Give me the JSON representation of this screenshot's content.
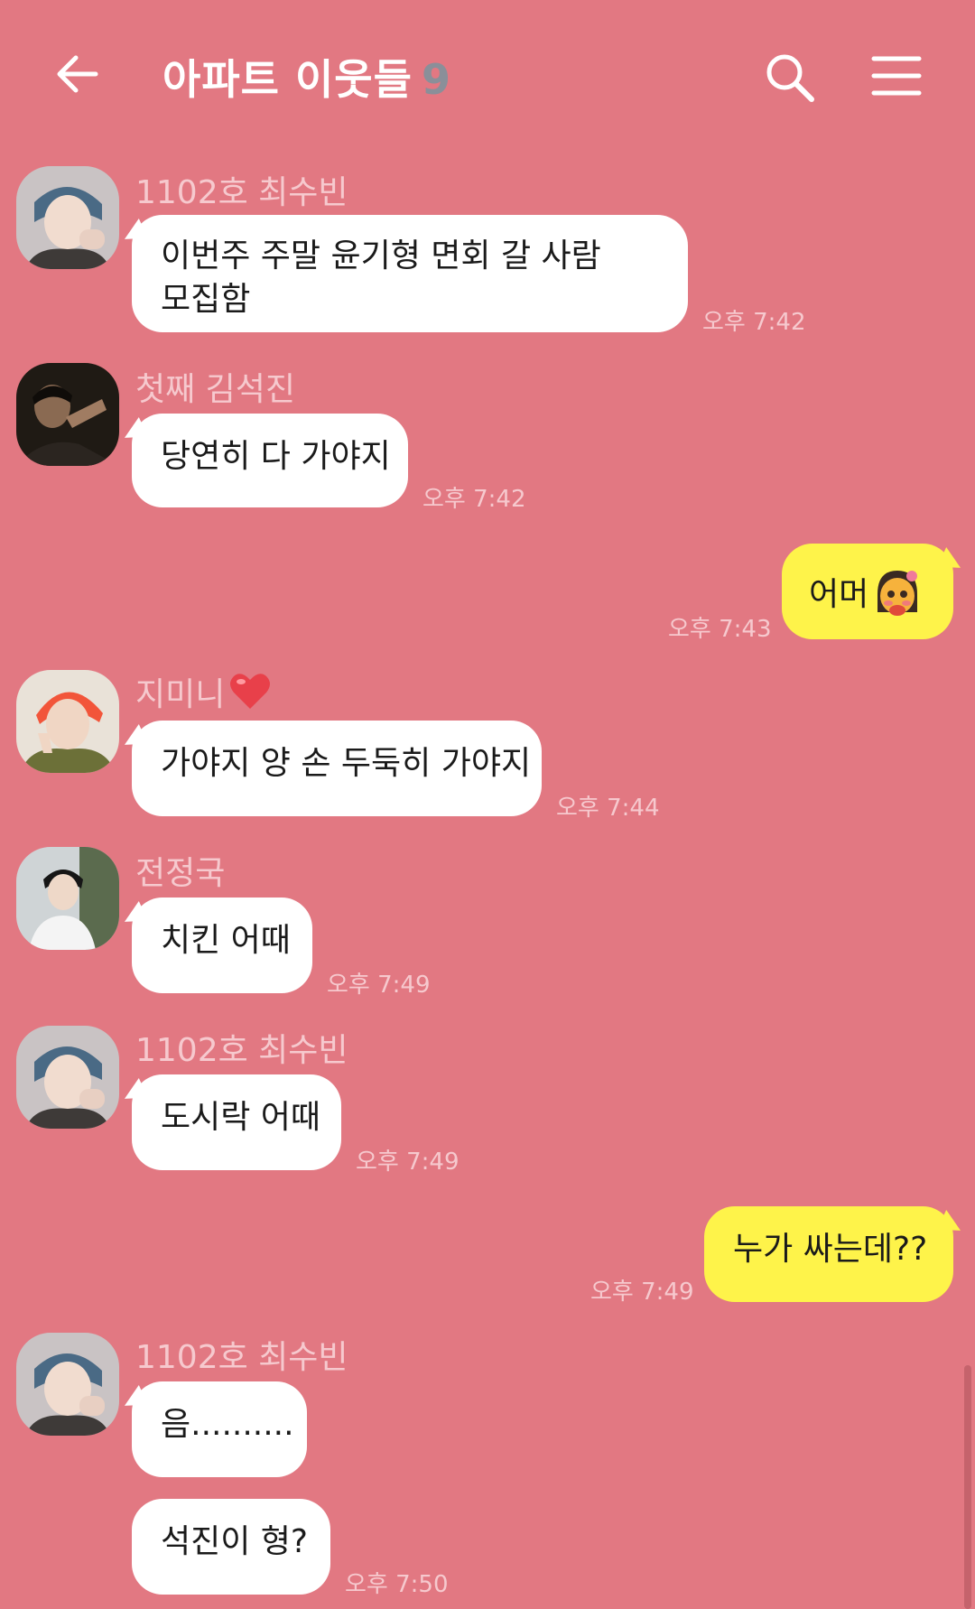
{
  "header": {
    "title": "아파트 이웃들",
    "member_count": "9"
  },
  "messages": [
    {
      "sender": "1102호 최수빈",
      "text_lines": [
        "이번주 주말 윤기형 면회 갈 사람",
        "모집함"
      ],
      "time": "오후 7:42"
    },
    {
      "sender": "첫째 김석진",
      "text": "당연히 다 가야지",
      "time": "오후 7:42"
    },
    {
      "sender": "me",
      "text": "어머",
      "emoji": "blushing-face-icon",
      "time": "오후 7:43"
    },
    {
      "sender": "지미니",
      "sender_emoji": "heart-icon",
      "text": "가야지 양 손 두둑히 가야지",
      "time": "오후 7:44"
    },
    {
      "sender": "전정국",
      "text": "치킨 어때",
      "time": "오후 7:49"
    },
    {
      "sender": "1102호 최수빈",
      "text": "도시락 어때",
      "time": "오후 7:49"
    },
    {
      "sender": "me",
      "text": "누가 싸는데??",
      "time": "오후 7:49"
    },
    {
      "sender": "1102호 최수빈",
      "texts": [
        "음..........",
        "석진이 형?"
      ],
      "time": "오후 7:50"
    }
  ],
  "colors": {
    "background": "#e27882",
    "my_bubble": "#fef34a",
    "other_bubble": "#ffffff",
    "name_text": "#f6c9ce"
  }
}
